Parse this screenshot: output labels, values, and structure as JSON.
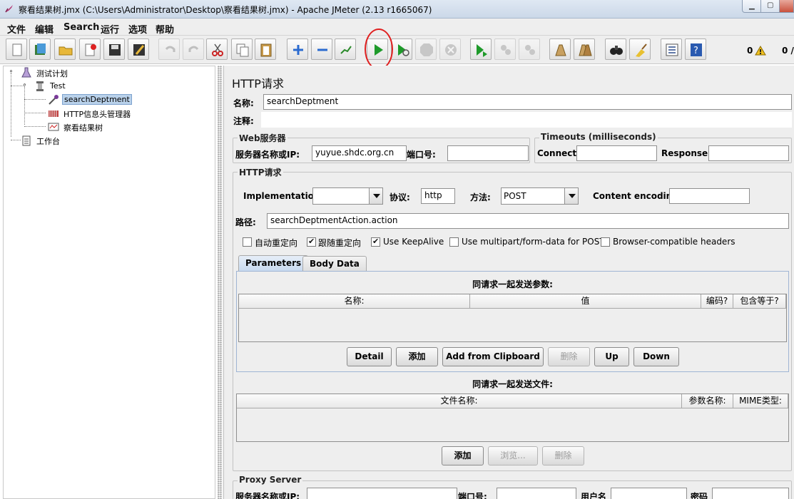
{
  "window": {
    "title": "察看结果树.jmx (C:\\Users\\Administrator\\Desktop\\察看结果树.jmx) - Apache JMeter (2.13 r1665067)"
  },
  "menu": [
    "文件",
    "编辑",
    "Search",
    "运行",
    "选项",
    "帮助"
  ],
  "toolbar": {
    "icons": [
      "new-icon",
      "templates-icon",
      "open-icon",
      "close-icon",
      "save-icon",
      "save-as-icon",
      "undo-icon",
      "redo-icon",
      "cut-icon",
      "copy-icon",
      "paste-icon",
      "expand-icon",
      "collapse-icon",
      "toggle-icon",
      "start-icon",
      "start-no-timers-icon",
      "stop-icon",
      "shutdown-icon",
      "remote-start-icon",
      "remote-stop-icon",
      "remote-shutdown-icon",
      "clear-icon",
      "clear-all-icon",
      "search-icon",
      "reset-search-icon",
      "function-helper-icon",
      "help-icon"
    ],
    "warning_count": "0",
    "thread_count": "0 /",
    "annotation": "运行"
  },
  "tree": {
    "root": "测试计划",
    "thread_group": "Test",
    "sampler": "searchDeptment",
    "header_manager": "HTTP信息头管理器",
    "listener": "察看结果树",
    "workbench": "工作台"
  },
  "panel": {
    "heading": "HTTP请求",
    "name_label": "名称:",
    "name_value": "searchDeptment",
    "comment_label": "注释:",
    "comment_value": "",
    "web_server": {
      "title": "Web服务器",
      "server_label": "服务器名称或IP:",
      "server_value": "yuyue.shdc.org.cn",
      "port_label": "端口号:",
      "port_value": ""
    },
    "timeouts": {
      "title": "Timeouts (milliseconds)",
      "connect_label": "Connect:",
      "connect_value": "",
      "response_label": "Response:",
      "response_value": ""
    },
    "http_request": {
      "title": "HTTP请求",
      "implementation_label": "Implementation:",
      "implementation_value": "",
      "protocol_label": "协议:",
      "protocol_value": "http",
      "method_label": "方法:",
      "method_value": "POST",
      "encoding_label": "Content encoding:",
      "encoding_value": "",
      "path_label": "路径:",
      "path_value": "searchDeptmentAction.action",
      "checkboxes": [
        {
          "label": "自动重定向",
          "checked": false
        },
        {
          "label": "跟随重定向",
          "checked": true
        },
        {
          "label": "Use KeepAlive",
          "checked": true
        },
        {
          "label": "Use multipart/form-data for POST",
          "checked": false
        },
        {
          "label": "Browser-compatible headers",
          "checked": false
        }
      ]
    },
    "tabs": [
      "Parameters",
      "Body Data"
    ],
    "params": {
      "title": "同请求一起发送参数:",
      "columns": [
        "名称:",
        "值",
        "编码?",
        "包含等于?"
      ],
      "buttons": [
        "Detail",
        "添加",
        "Add from Clipboard",
        "删除",
        "Up",
        "Down"
      ]
    },
    "files": {
      "title": "同请求一起发送文件:",
      "columns": [
        "文件名称:",
        "参数名称:",
        "MIME类型:"
      ],
      "buttons": [
        "添加",
        "浏览...",
        "删除"
      ]
    },
    "proxy": {
      "title": "Proxy Server",
      "server_label": "服务器名称或IP:",
      "port_label": "端口号:",
      "user_label": "用户名",
      "password_label": "密码"
    }
  }
}
